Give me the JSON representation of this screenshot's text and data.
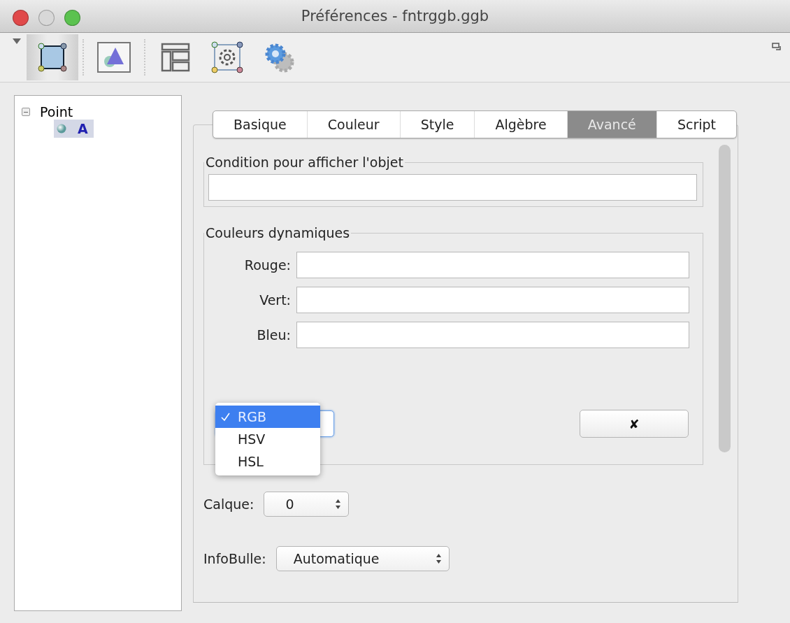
{
  "window": {
    "title": "Préférences - fntrggb.ggb"
  },
  "toolbar": {
    "buttons": [
      {
        "kind": "polygon",
        "selected": true
      },
      {
        "kind": "triangle",
        "selected": false
      },
      {
        "kind": "layout",
        "selected": false
      },
      {
        "kind": "object-gear",
        "selected": false
      },
      {
        "kind": "gears",
        "selected": false
      }
    ]
  },
  "tree": {
    "items": [
      {
        "label": "Point",
        "expanded": true,
        "selected": false,
        "children": [
          {
            "label": "A",
            "selected": true
          }
        ]
      }
    ]
  },
  "tabs": [
    {
      "label": "Basique",
      "selected": false
    },
    {
      "label": "Couleur",
      "selected": false
    },
    {
      "label": "Style",
      "selected": false
    },
    {
      "label": "Algèbre",
      "selected": false
    },
    {
      "label": "Avancé",
      "selected": true
    },
    {
      "label": "Script",
      "selected": false
    }
  ],
  "condition": {
    "title": "Condition pour afficher l'objet"
  },
  "dynamic_colors": {
    "title": "Couleurs dynamiques",
    "fields": [
      {
        "label": "Rouge:"
      },
      {
        "label": "Vert:"
      },
      {
        "label": "Bleu:"
      }
    ],
    "model_menu": {
      "items": [
        {
          "label": "RGB",
          "selected": true
        },
        {
          "label": "HSV",
          "selected": false
        },
        {
          "label": "HSL",
          "selected": false
        }
      ]
    },
    "clear_button": "✘"
  },
  "layer": {
    "label": "Calque:",
    "value": "0"
  },
  "tooltip": {
    "label": "InfoBulle:",
    "value": "Automatique"
  }
}
